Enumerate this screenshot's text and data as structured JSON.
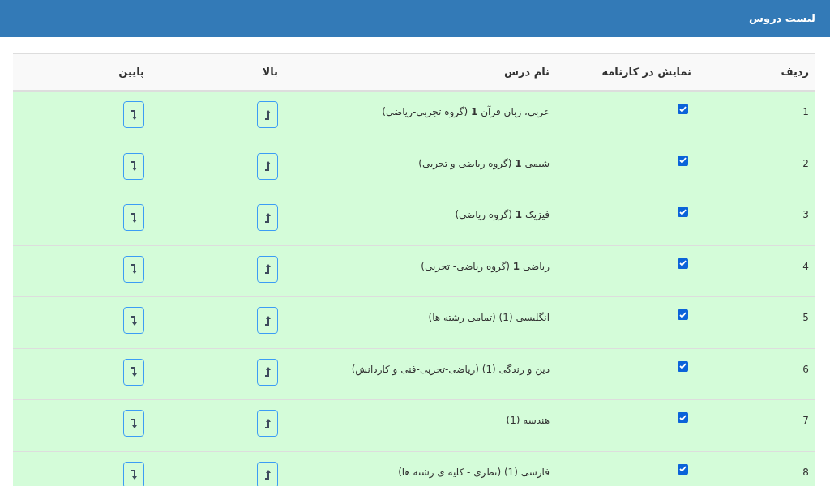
{
  "header": {
    "title": "لیست دروس"
  },
  "table": {
    "columns": [
      "ردیف",
      "نمایش در کارنامه",
      "نام درس",
      "بالا",
      "پایین"
    ],
    "rows": [
      {
        "index": "1",
        "show_in_report": true,
        "name": "عربی، زبان قرآن **1** (گروه تجربی-ریاضی)"
      },
      {
        "index": "2",
        "show_in_report": true,
        "name": "شیمی **1** (گروه ریاضی و تجربی)"
      },
      {
        "index": "3",
        "show_in_report": true,
        "name": "فیزیک **1** (گروه ریاضی)"
      },
      {
        "index": "4",
        "show_in_report": true,
        "name": "ریاضی **1** (گروه ریاضی- تجربی)"
      },
      {
        "index": "5",
        "show_in_report": true,
        "name": "انگلیسی (1) (تمامی رشته ها)"
      },
      {
        "index": "6",
        "show_in_report": true,
        "name": "دین و زندگی (1) (ریاضی-تجربی-فنی و کاردانش)"
      },
      {
        "index": "7",
        "show_in_report": true,
        "name": "هندسه (1)"
      },
      {
        "index": "8",
        "show_in_report": true,
        "name": "فارسی (1) (نظری - کلیه ی رشته ها)"
      }
    ]
  }
}
